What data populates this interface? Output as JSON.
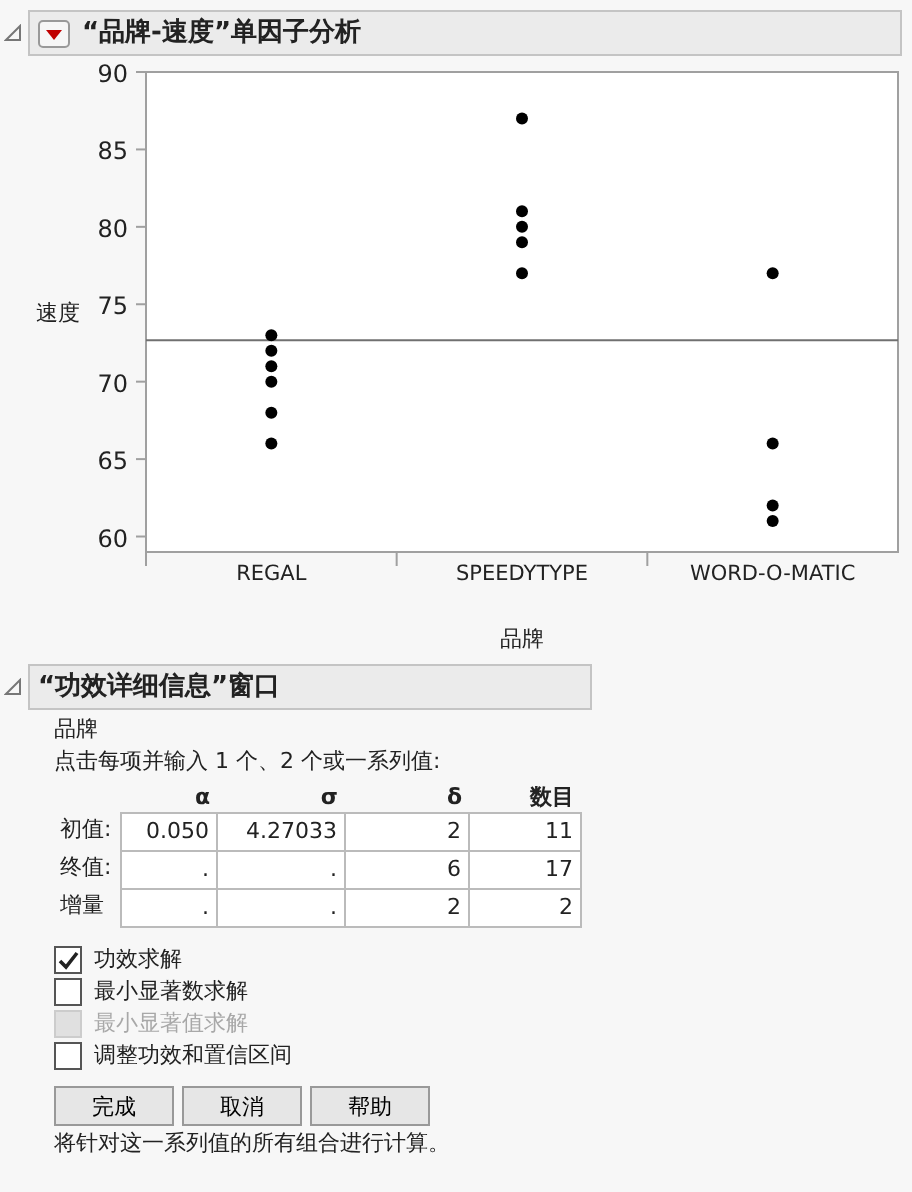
{
  "report": {
    "title": "“品牌-速度”单因子分析",
    "expanded": true
  },
  "plot": {
    "chart_data": {
      "type": "scatter",
      "xlabel": "品牌",
      "ylabel": "速度",
      "categories": [
        "REGAL",
        "SPEEDYTYPE",
        "WORD-O-MATIC"
      ],
      "ylim": [
        59,
        90
      ],
      "yticks": [
        60,
        65,
        70,
        75,
        80,
        85,
        90
      ],
      "series": [
        {
          "color": "#000000",
          "x": [
            "REGAL",
            "REGAL",
            "REGAL",
            "REGAL",
            "REGAL",
            "REGAL",
            "SPEEDYTYPE",
            "SPEEDYTYPE",
            "SPEEDYTYPE",
            "SPEEDYTYPE",
            "SPEEDYTYPE",
            "WORD-O-MATIC",
            "WORD-O-MATIC",
            "WORD-O-MATIC",
            "WORD-O-MATIC"
          ],
          "values": [
            73,
            72,
            71,
            70,
            68,
            66,
            87,
            81,
            80,
            79,
            77,
            77,
            66,
            62,
            61
          ]
        }
      ],
      "ref_lines": [
        {
          "axis": "y",
          "value": 72.67
        }
      ]
    }
  },
  "power": {
    "title": "“功效详细信息”窗口",
    "expanded": true,
    "group": "品牌",
    "instruction": "点击每项并输入 1 个、2 个或一系列值:",
    "columns": [
      "α",
      "σ",
      "δ",
      "数目"
    ],
    "rows": [
      {
        "label": "初值:",
        "cells": [
          "0.050",
          "4.27033",
          "2",
          "11"
        ]
      },
      {
        "label": "终值:",
        "cells": [
          ".",
          ".",
          "6",
          "17"
        ]
      },
      {
        "label": "增量",
        "cells": [
          ".",
          ".",
          "2",
          "2"
        ]
      }
    ],
    "options": [
      {
        "label": "功效求解",
        "checked": true,
        "disabled": false
      },
      {
        "label": "最小显著数求解",
        "checked": false,
        "disabled": false
      },
      {
        "label": "最小显著值求解",
        "checked": false,
        "disabled": true
      },
      {
        "label": "调整功效和置信区间",
        "checked": false,
        "disabled": false
      }
    ],
    "buttons": [
      "完成",
      "取消",
      "帮助"
    ],
    "note": "将针对这一系列值的所有组合进行计算。"
  }
}
